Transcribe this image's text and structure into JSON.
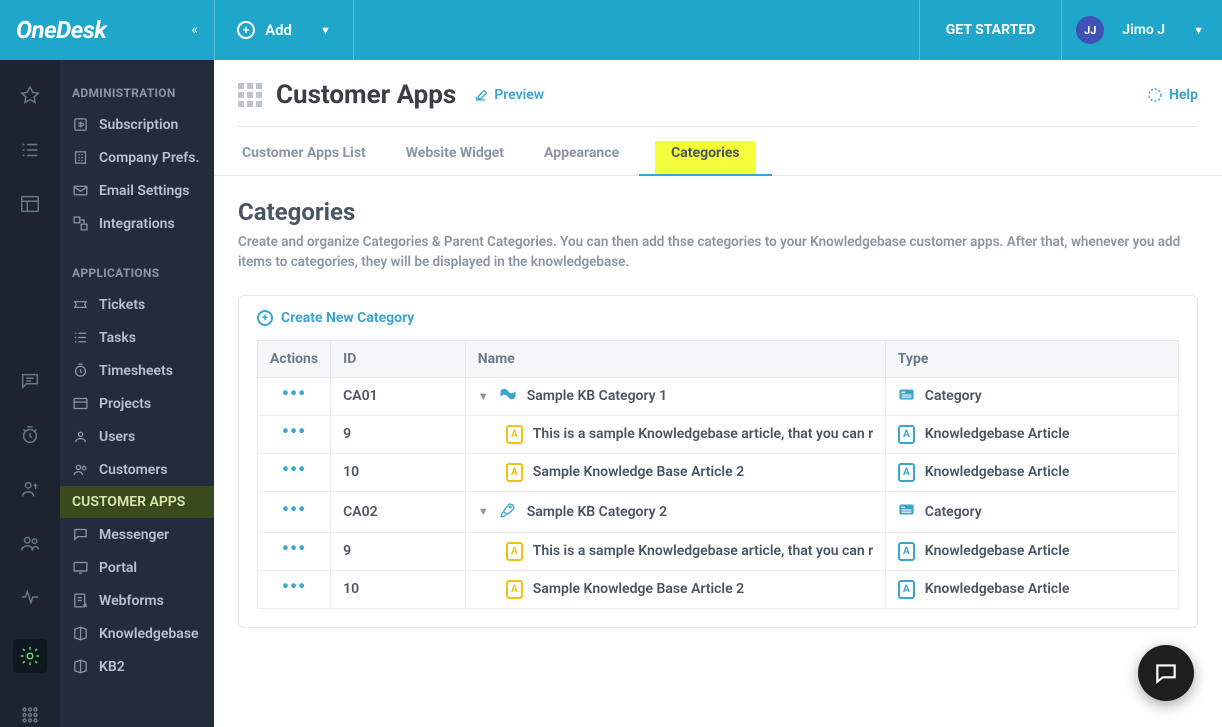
{
  "topbar": {
    "logo": "OneDesk",
    "add": "Add",
    "get_started": "GET STARTED",
    "avatar": "JJ",
    "user": "Jimo J"
  },
  "sidebar": {
    "section_admin": "ADMINISTRATION",
    "admin_items": [
      {
        "label": "Subscription"
      },
      {
        "label": "Company Prefs."
      },
      {
        "label": "Email Settings"
      },
      {
        "label": "Integrations"
      }
    ],
    "section_apps": "APPLICATIONS",
    "app_items": [
      {
        "label": "Tickets"
      },
      {
        "label": "Tasks"
      },
      {
        "label": "Timesheets"
      },
      {
        "label": "Projects"
      },
      {
        "label": "Users"
      },
      {
        "label": "Customers"
      },
      {
        "label": "CUSTOMER APPS",
        "active": true
      },
      {
        "label": "Messenger"
      },
      {
        "label": "Portal"
      },
      {
        "label": "Webforms"
      },
      {
        "label": "Knowledgebase"
      },
      {
        "label": "KB2"
      }
    ]
  },
  "page": {
    "title": "Customer Apps",
    "preview": "Preview",
    "help": "Help"
  },
  "tabs": [
    {
      "label": "Customer Apps List"
    },
    {
      "label": "Website Widget"
    },
    {
      "label": "Appearance"
    },
    {
      "label": "Categories",
      "active": true
    }
  ],
  "section": {
    "title": "Categories",
    "desc": "Create and organize Categories & Parent Categories. You can then add thse categories to your Knowledgebase customer apps. After that, whenever you add items to categories, they will be displayed in the knowledgebase.",
    "create": "Create New Category"
  },
  "table": {
    "headers": {
      "actions": "Actions",
      "id": "ID",
      "name": "Name",
      "type": "Type"
    },
    "rows": [
      {
        "kind": "cat",
        "id": "CA01",
        "name": "Sample KB Category 1",
        "type": "Category"
      },
      {
        "kind": "art",
        "id": "9",
        "name": "This is a sample Knowledgebase article, that you can ret",
        "type": "Knowledgebase Article"
      },
      {
        "kind": "art",
        "id": "10",
        "name": "Sample Knowledge Base Article 2",
        "type": "Knowledgebase Article"
      },
      {
        "kind": "cat2",
        "id": "CA02",
        "name": "Sample KB Category 2",
        "type": "Category"
      },
      {
        "kind": "art",
        "id": "9",
        "name": "This is a sample Knowledgebase article, that you can ret",
        "type": "Knowledgebase Article"
      },
      {
        "kind": "art",
        "id": "10",
        "name": "Sample Knowledge Base Article 2",
        "type": "Knowledgebase Article"
      }
    ]
  }
}
